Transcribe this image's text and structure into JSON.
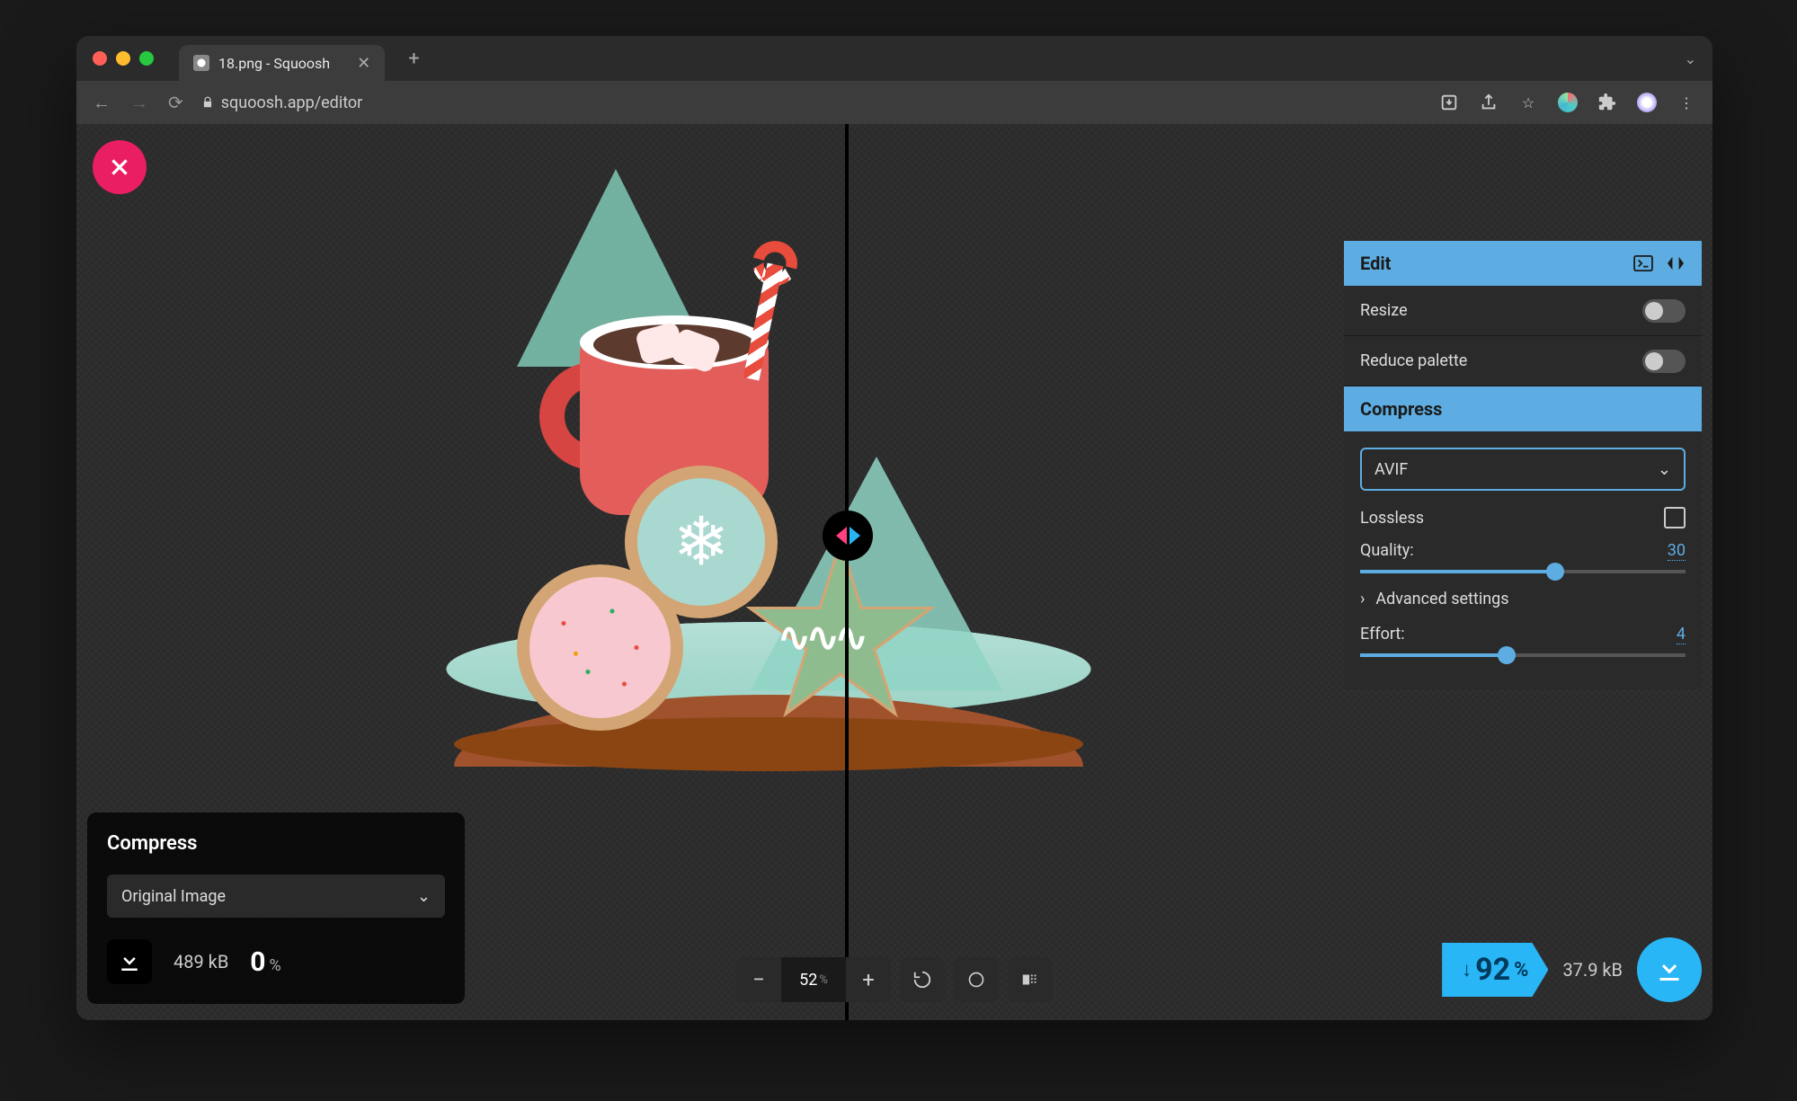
{
  "browser": {
    "tab_title": "18.png - Squoosh",
    "url": "squoosh.app/editor"
  },
  "close_label": "Close",
  "left_panel": {
    "title": "Compress",
    "codec_select": "Original Image",
    "size": "489 kB",
    "percent": "0",
    "percent_unit": "%"
  },
  "right_panel": {
    "edit_header": "Edit",
    "resize_label": "Resize",
    "reduce_palette_label": "Reduce palette",
    "compress_header": "Compress",
    "codec_select": "AVIF",
    "lossless_label": "Lossless",
    "quality_label": "Quality:",
    "quality_value": "30",
    "advanced_label": "Advanced settings",
    "effort_label": "Effort:",
    "effort_value": "4"
  },
  "output": {
    "savings_arrow": "↓",
    "savings_percent": "92",
    "savings_unit": "%",
    "size": "37.9 kB"
  },
  "zoom": {
    "minus": "−",
    "plus": "+",
    "value": "52",
    "unit": "%"
  }
}
